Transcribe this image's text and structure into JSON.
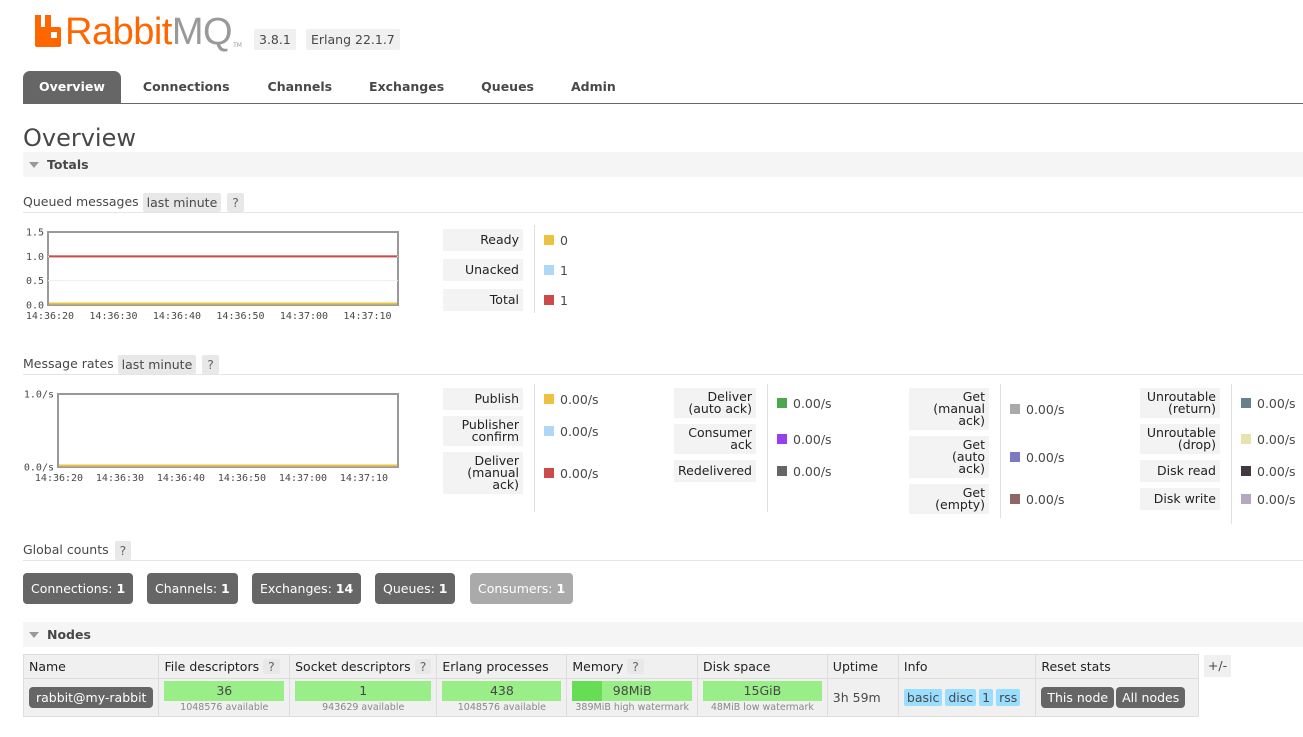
{
  "header": {
    "logo_rabbit": "Rabbit",
    "logo_mq": "MQ",
    "logo_tm": "TM",
    "version": "3.8.1",
    "erlang": "Erlang 22.1.7"
  },
  "tabs": [
    "Overview",
    "Connections",
    "Channels",
    "Exchanges",
    "Queues",
    "Admin"
  ],
  "page_title": "Overview",
  "totals": {
    "section_label": "Totals",
    "queued": {
      "label": "Queued messages",
      "range": "last minute",
      "help": "?",
      "y_ticks": [
        "1.5",
        "1.0",
        "0.5",
        "0.0"
      ],
      "x_ticks": [
        "14:36:20",
        "14:36:30",
        "14:36:40",
        "14:36:50",
        "14:37:00",
        "14:37:10"
      ],
      "legend": [
        {
          "label": "Ready",
          "value": "0",
          "color": "#edc240"
        },
        {
          "label": "Unacked",
          "value": "1",
          "color": "#afd8f8"
        },
        {
          "label": "Total",
          "value": "1",
          "color": "#cb4b4b"
        }
      ]
    },
    "rates": {
      "label": "Message rates",
      "range": "last minute",
      "help": "?",
      "y_ticks": [
        "1.0/s",
        "0.0/s"
      ],
      "x_ticks": [
        "14:36:20",
        "14:36:30",
        "14:36:40",
        "14:36:50",
        "14:37:00",
        "14:37:10"
      ],
      "legend_cols": [
        [
          {
            "label": "Publish",
            "value": "0.00/s",
            "color": "#edc240"
          },
          {
            "label": "Publisher confirm",
            "value": "0.00/s",
            "color": "#afd8f8"
          },
          {
            "label": "Deliver (manual ack)",
            "value": "0.00/s",
            "color": "#cb4b4b"
          }
        ],
        [
          {
            "label": "Deliver (auto ack)",
            "value": "0.00/s",
            "color": "#4da74d"
          },
          {
            "label": "Consumer ack",
            "value": "0.00/s",
            "color": "#9440ed"
          },
          {
            "label": "Redelivered",
            "value": "0.00/s",
            "color": "#666666"
          }
        ],
        [
          {
            "label": "Get (manual ack)",
            "value": "0.00/s",
            "color": "#aaaaaa"
          },
          {
            "label": "Get (auto ack)",
            "value": "0.00/s",
            "color": "#7c79c3"
          },
          {
            "label": "Get (empty)",
            "value": "0.00/s",
            "color": "#8e6767"
          }
        ],
        [
          {
            "label": "Unroutable (return)",
            "value": "0.00/s",
            "color": "#67808e"
          },
          {
            "label": "Unroutable (drop)",
            "value": "0.00/s",
            "color": "#e5e4ae"
          },
          {
            "label": "Disk read",
            "value": "0.00/s",
            "color": "#423840"
          },
          {
            "label": "Disk write",
            "value": "0.00/s",
            "color": "#b5a7c1"
          }
        ]
      ]
    },
    "global": {
      "label": "Global counts",
      "help": "?",
      "counts": [
        {
          "label": "Connections:",
          "value": "1"
        },
        {
          "label": "Channels:",
          "value": "1"
        },
        {
          "label": "Exchanges:",
          "value": "14"
        },
        {
          "label": "Queues:",
          "value": "1"
        },
        {
          "label": "Consumers:",
          "value": "1"
        }
      ]
    }
  },
  "nodes": {
    "section_label": "Nodes",
    "plusminus": "+/-",
    "columns": {
      "name": "Name",
      "fd": "File descriptors",
      "sockets": "Socket descriptors",
      "erlang": "Erlang processes",
      "memory": "Memory",
      "disk": "Disk space",
      "uptime": "Uptime",
      "info": "Info",
      "reset": "Reset stats"
    },
    "help": "?",
    "row": {
      "name": "rabbit@my-rabbit",
      "fd": {
        "value": "36",
        "sub": "1048576 available"
      },
      "sockets": {
        "value": "1",
        "sub": "943629 available"
      },
      "erlang": {
        "value": "438",
        "sub": "1048576 available"
      },
      "memory": {
        "value": "98MiB",
        "sub": "389MiB high watermark",
        "fraction": 0.25
      },
      "disk": {
        "value": "15GiB",
        "sub": "48MiB low watermark"
      },
      "uptime": "3h 59m",
      "info": [
        "basic",
        "disc",
        "1",
        "rss"
      ],
      "reset_this": "This node",
      "reset_all": "All nodes"
    }
  },
  "chart_data": [
    {
      "type": "line",
      "title": "Queued messages",
      "x": [
        "14:36:20",
        "14:36:30",
        "14:36:40",
        "14:36:50",
        "14:37:00",
        "14:37:10"
      ],
      "ylim": [
        0,
        1.5
      ],
      "series": [
        {
          "name": "Ready",
          "values": [
            0,
            0,
            0,
            0,
            0,
            0
          ],
          "color": "#edc240"
        },
        {
          "name": "Unacked",
          "values": [
            1,
            1,
            1,
            1,
            1,
            1
          ],
          "color": "#afd8f8"
        },
        {
          "name": "Total",
          "values": [
            1,
            1,
            1,
            1,
            1,
            1
          ],
          "color": "#cb4b4b"
        }
      ]
    },
    {
      "type": "line",
      "title": "Message rates",
      "x": [
        "14:36:20",
        "14:36:30",
        "14:36:40",
        "14:36:50",
        "14:37:00",
        "14:37:10"
      ],
      "ylim": [
        0,
        1.0
      ],
      "series": [
        {
          "name": "Publish",
          "values": [
            0,
            0,
            0,
            0,
            0,
            0
          ],
          "color": "#edc240"
        }
      ]
    }
  ]
}
